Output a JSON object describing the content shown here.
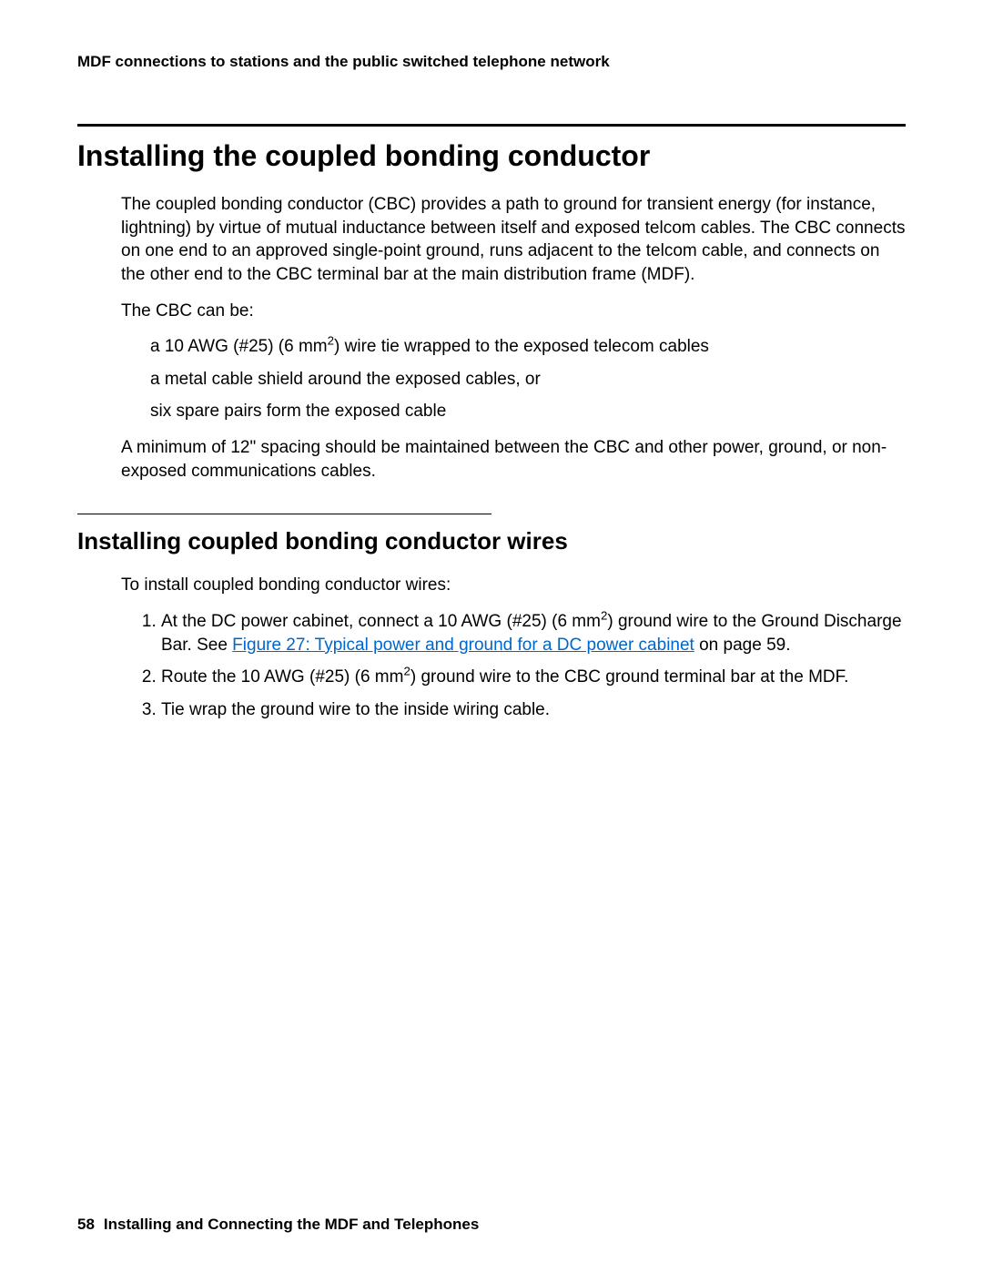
{
  "header": {
    "running": "MDF connections to stations and the public switched telephone network"
  },
  "section1": {
    "title": "Installing the coupled bonding conductor",
    "p1": "The coupled bonding conductor (CBC) provides a path to ground for transient energy (for instance, lightning) by virtue of mutual inductance between itself and exposed telcom cables. The CBC connects on one end to an approved single-point ground, runs adjacent to the telcom cable, and connects on the other end to the CBC terminal bar at the main distribution frame (MDF).",
    "p2": "The CBC can be:",
    "bullets": {
      "b1_pre": "a 10 AWG (#25) (6 mm",
      "b1_sup": "2",
      "b1_post": ") wire tie wrapped to the exposed telecom cables",
      "b2": "a metal cable shield around the exposed cables, or",
      "b3": "six spare pairs form the exposed cable"
    },
    "p3": "A minimum of 12\" spacing should be maintained between the CBC and other power, ground, or non-exposed communications cables."
  },
  "section2": {
    "title": "Installing coupled bonding conductor wires",
    "intro": "To install coupled bonding conductor wires:",
    "steps": {
      "s1_pre": "At the DC power cabinet, connect a 10 AWG (#25) (6 mm",
      "s1_sup": "2",
      "s1_mid": ") ground wire to the Ground Discharge Bar. See ",
      "s1_link": "Figure 27:  Typical power and ground for a DC power cabinet",
      "s1_post": " on page 59.",
      "s2_pre": "Route the 10 AWG (#25) (6 mm",
      "s2_sup": "2",
      "s2_post": ") ground wire to the CBC ground terminal bar at the MDF.",
      "s3": "Tie wrap the ground wire to the inside wiring cable."
    }
  },
  "footer": {
    "page_number": "58",
    "title": "Installing and Connecting the MDF and Telephones"
  }
}
